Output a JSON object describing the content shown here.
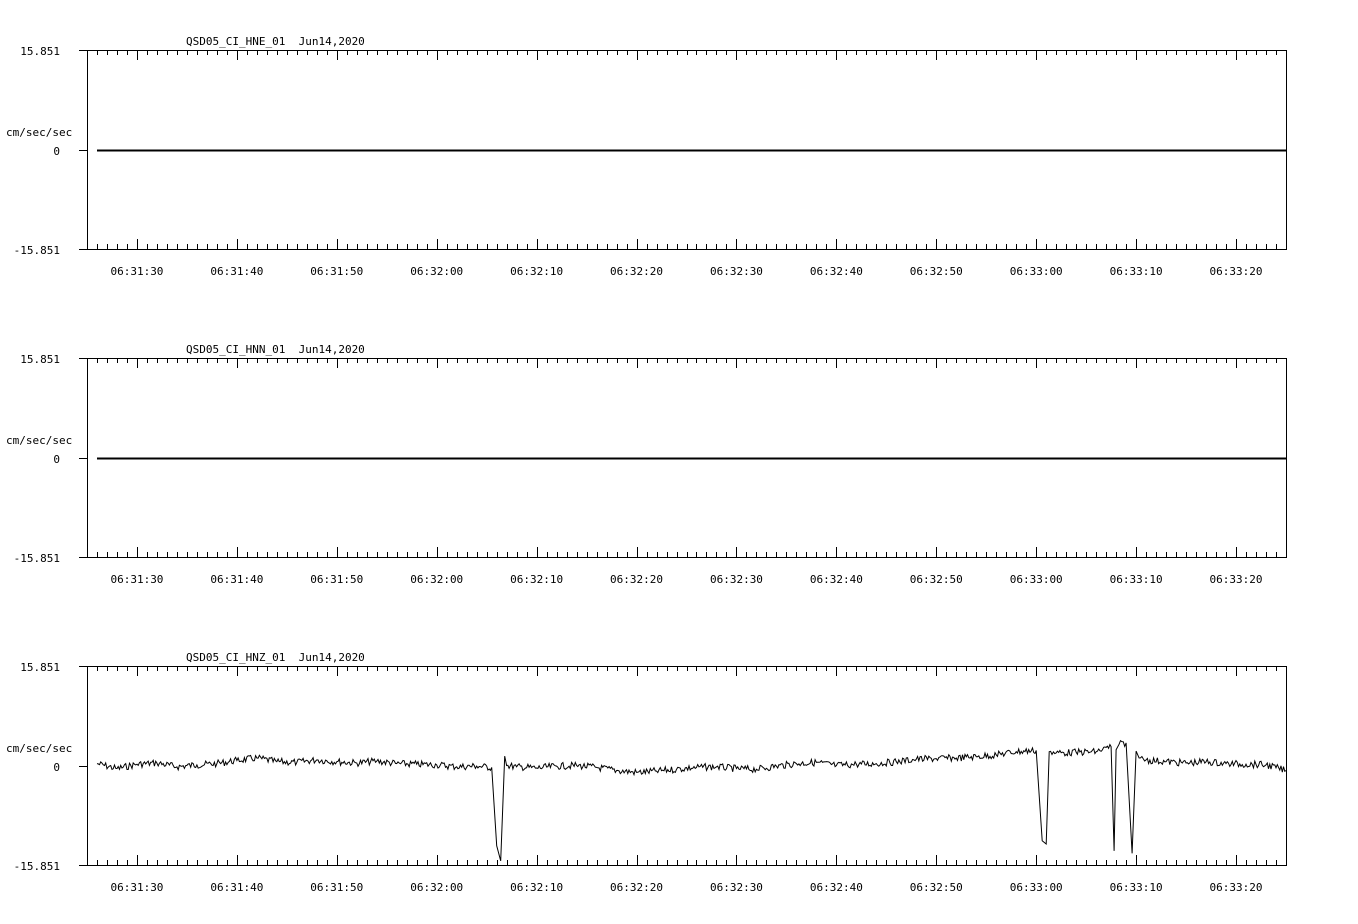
{
  "chart_data": [
    {
      "type": "line",
      "title": "QSD05_CI_HNE_01  Jun14,2020",
      "ylabel": "cm/sec/sec",
      "ylim": [
        -15.851,
        15.851
      ],
      "ytick_labels": [
        "15.851",
        "0",
        "-15.851"
      ],
      "xlim": [
        "06:31:25",
        "06:33:25"
      ],
      "xtick_labels": [
        "06:31:30",
        "06:31:40",
        "06:31:50",
        "06:32:00",
        "06:32:10",
        "06:32:20",
        "06:32:30",
        "06:32:40",
        "06:32:50",
        "06:33:00",
        "06:33:10",
        "06:33:20"
      ],
      "series": [
        {
          "x": [
            "06:31:26",
            "06:33:25"
          ],
          "y": [
            0,
            0
          ]
        }
      ]
    },
    {
      "type": "line",
      "title": "QSD05_CI_HNN_01  Jun14,2020",
      "ylabel": "cm/sec/sec",
      "ylim": [
        -15.851,
        15.851
      ],
      "ytick_labels": [
        "15.851",
        "0",
        "-15.851"
      ],
      "xlim": [
        "06:31:25",
        "06:33:25"
      ],
      "xtick_labels": [
        "06:31:30",
        "06:31:40",
        "06:31:50",
        "06:32:00",
        "06:32:10",
        "06:32:20",
        "06:32:30",
        "06:32:40",
        "06:32:50",
        "06:33:00",
        "06:33:10",
        "06:33:20"
      ],
      "series": [
        {
          "x": [
            "06:31:26",
            "06:33:25"
          ],
          "y": [
            0,
            0
          ]
        }
      ]
    },
    {
      "type": "line",
      "title": "QSD05_CI_HNZ_01  Jun14,2020",
      "ylabel": "cm/sec/sec",
      "ylim": [
        -15.851,
        15.851
      ],
      "ytick_labels": [
        "15.851",
        "0",
        "-15.851"
      ],
      "xlim": [
        "06:31:25",
        "06:33:25"
      ],
      "xtick_labels": [
        "06:31:30",
        "06:31:40",
        "06:31:50",
        "06:32:00",
        "06:32:10",
        "06:32:20",
        "06:32:30",
        "06:32:40",
        "06:32:50",
        "06:33:00",
        "06:33:10",
        "06:33:20"
      ],
      "series": [
        {
          "x": [
            "06:31:26",
            "06:31:28",
            "06:31:30",
            "06:31:32",
            "06:31:34",
            "06:31:36",
            "06:31:38",
            "06:31:40",
            "06:31:42",
            "06:31:44",
            "06:31:46",
            "06:31:48",
            "06:31:50",
            "06:31:52",
            "06:31:54",
            "06:31:56",
            "06:31:58",
            "06:32:00",
            "06:32:02",
            "06:32:04",
            "06:32:05.5",
            "06:32:06",
            "06:32:06.4",
            "06:32:06.8",
            "06:32:07",
            "06:32:08",
            "06:32:10",
            "06:32:12",
            "06:32:14",
            "06:32:16",
            "06:32:18",
            "06:32:20",
            "06:32:22",
            "06:32:24",
            "06:32:26",
            "06:32:28",
            "06:32:30",
            "06:32:32",
            "06:32:34",
            "06:32:36",
            "06:32:38",
            "06:32:40",
            "06:32:42",
            "06:32:44",
            "06:32:46",
            "06:32:48",
            "06:32:50",
            "06:32:52",
            "06:32:54",
            "06:32:56",
            "06:32:58",
            "06:33:00",
            "06:33:00.6",
            "06:33:01",
            "06:33:01.3",
            "06:33:02",
            "06:33:04",
            "06:33:06",
            "06:33:07.5",
            "06:33:07.8",
            "06:33:08",
            "06:33:08.3",
            "06:33:09",
            "06:33:09.6",
            "06:33:10",
            "06:33:10.3",
            "06:33:11",
            "06:33:13",
            "06:33:15",
            "06:33:17",
            "06:33:19",
            "06:33:21",
            "06:33:23",
            "06:33:25"
          ],
          "y": [
            0.3,
            -0.5,
            0.2,
            0.4,
            -0.2,
            0.1,
            0.3,
            0.8,
            1.2,
            0.6,
            0.5,
            0.9,
            0.6,
            0.4,
            0.7,
            0.3,
            0.2,
            0.1,
            -0.2,
            -0.1,
            -0.3,
            -12.8,
            -15.2,
            1.5,
            0.0,
            -0.2,
            -0.4,
            -0.1,
            0.0,
            -0.3,
            -0.8,
            -1.1,
            -0.9,
            -0.6,
            -0.3,
            -0.2,
            -0.5,
            -0.6,
            -0.1,
            0.3,
            0.5,
            0.0,
            0.2,
            0.3,
            0.6,
            1.0,
            1.1,
            1.2,
            1.4,
            1.7,
            2.2,
            2.4,
            -12.0,
            -12.5,
            2.2,
            2.0,
            2.1,
            2.2,
            3.0,
            -13.6,
            2.5,
            3.4,
            3.6,
            -14.0,
            2.3,
            1.2,
            0.9,
            0.6,
            0.4,
            0.6,
            0.3,
            0.2,
            0.1,
            -0.8
          ]
        }
      ]
    }
  ]
}
